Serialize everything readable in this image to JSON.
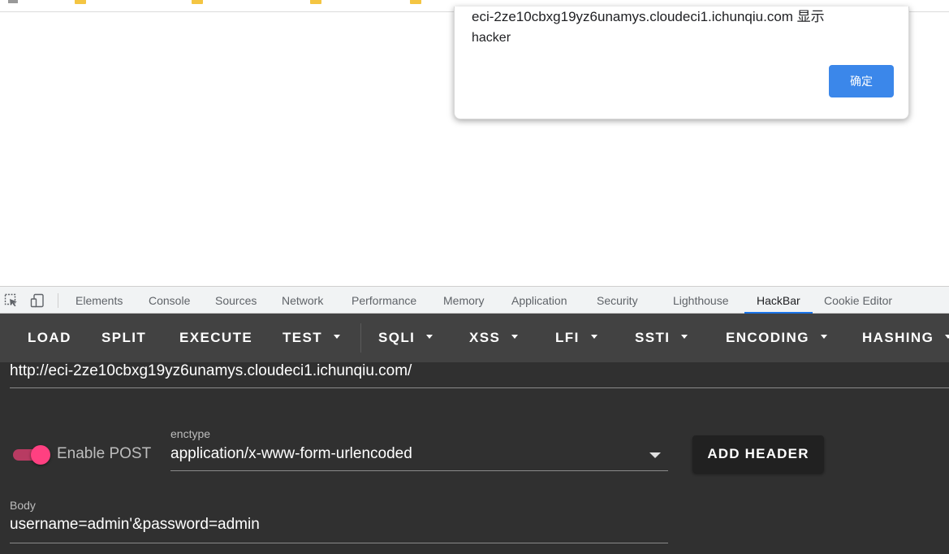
{
  "dialog": {
    "title": "eci-2ze10cbxg19yz6unamys.cloudeci1.ichunqiu.com 显示",
    "message": "hacker",
    "ok_label": "确定"
  },
  "devtools": {
    "tabs": [
      "Elements",
      "Console",
      "Sources",
      "Network",
      "Performance",
      "Memory",
      "Application",
      "Security",
      "Lighthouse",
      "HackBar",
      "Cookie Editor"
    ],
    "active_tab": "HackBar"
  },
  "hackbar": {
    "buttons": {
      "load": "LOAD",
      "split": "SPLIT",
      "execute": "EXECUTE",
      "test": "TEST",
      "sqli": "SQLI",
      "xss": "XSS",
      "lfi": "LFI",
      "ssti": "SSTI",
      "encoding": "ENCODING",
      "hashing": "HASHING"
    },
    "url": "http://eci-2ze10cbxg19yz6unamys.cloudeci1.ichunqiu.com/",
    "enable_post_label": "Enable POST",
    "enable_post_on": true,
    "enctype_label": "enctype",
    "enctype_value": "application/x-www-form-urlencoded",
    "add_header_label": "ADD HEADER",
    "body_label": "Body",
    "body_value": "username=admin'&password=admin"
  },
  "colors": {
    "dialog_button": "#3b87ea",
    "toolbar_bg": "#424242",
    "panel_bg": "#303030",
    "toggle_accent": "#ff4081",
    "active_tab_underline": "#1a73e8"
  }
}
